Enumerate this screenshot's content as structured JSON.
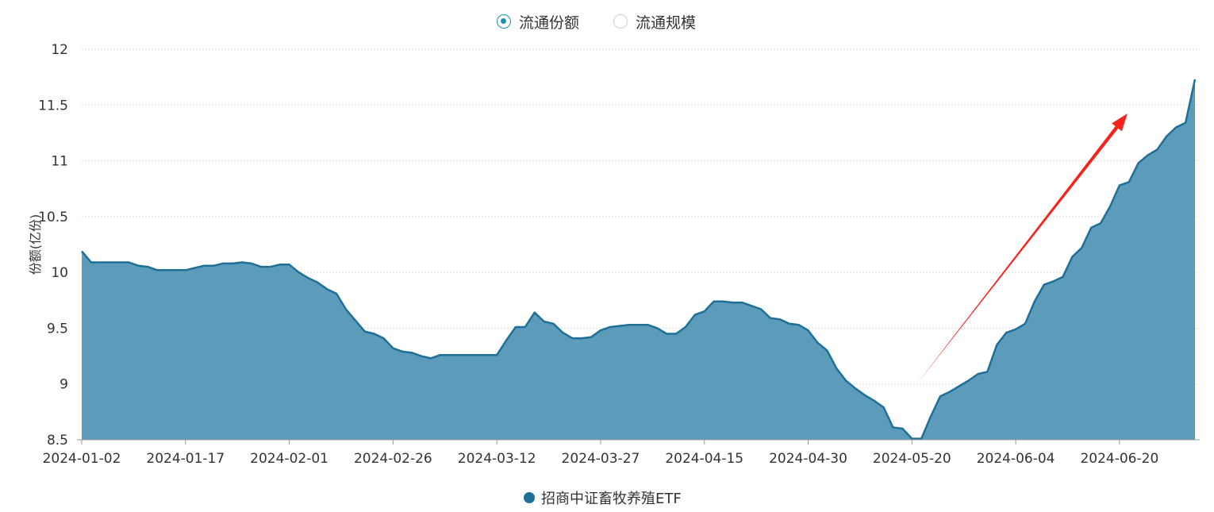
{
  "toggles": [
    {
      "label": "流通份额",
      "selected": true
    },
    {
      "label": "流通规模",
      "selected": false
    }
  ],
  "colors": {
    "series": "#1f6f97",
    "fill": "#5c9bba",
    "arrow": "#f5231c",
    "radio": "#1e8fb0"
  },
  "chart_data": {
    "type": "area",
    "ylabel": "份额(亿份)",
    "ylim": [
      8.5,
      12
    ],
    "yticks": [
      8.5,
      9,
      9.5,
      10,
      10.5,
      11,
      11.5,
      12
    ],
    "ytick_labels": [
      "8.5",
      "9",
      "9.5",
      "10",
      "10.5",
      "11",
      "11.5",
      "12"
    ],
    "xtick_labels": [
      "2024-01-02",
      "2024-01-17",
      "2024-02-01",
      "2024-02-26",
      "2024-03-12",
      "2024-03-27",
      "2024-04-15",
      "2024-04-30",
      "2024-05-20",
      "2024-06-04",
      "2024-06-20"
    ],
    "xtick_index": [
      0,
      11,
      22,
      33,
      44,
      55,
      66,
      77,
      88,
      99,
      110
    ],
    "grid": true,
    "legend_position": "bottom-center",
    "series": [
      {
        "name": "招商中证畜牧养殖ETF",
        "values": [
          10.19,
          10.09,
          10.09,
          10.09,
          10.09,
          10.09,
          10.06,
          10.05,
          10.02,
          10.02,
          10.02,
          10.02,
          10.04,
          10.06,
          10.06,
          10.08,
          10.08,
          10.09,
          10.08,
          10.05,
          10.05,
          10.07,
          10.07,
          10.0,
          9.95,
          9.91,
          9.85,
          9.81,
          9.67,
          9.57,
          9.47,
          9.45,
          9.41,
          9.32,
          9.29,
          9.28,
          9.25,
          9.23,
          9.26,
          9.26,
          9.26,
          9.26,
          9.26,
          9.26,
          9.26,
          9.39,
          9.51,
          9.51,
          9.64,
          9.56,
          9.54,
          9.46,
          9.41,
          9.41,
          9.42,
          9.48,
          9.51,
          9.52,
          9.53,
          9.53,
          9.53,
          9.5,
          9.45,
          9.45,
          9.51,
          9.62,
          9.65,
          9.74,
          9.74,
          9.73,
          9.73,
          9.7,
          9.67,
          9.59,
          9.58,
          9.54,
          9.53,
          9.48,
          9.37,
          9.3,
          9.14,
          9.03,
          8.96,
          8.9,
          8.85,
          8.79,
          8.61,
          8.6,
          8.51,
          8.51,
          8.71,
          8.89,
          8.93,
          8.98,
          9.03,
          9.09,
          9.11,
          9.35,
          9.46,
          9.49,
          9.54,
          9.74,
          9.89,
          9.92,
          9.96,
          10.14,
          10.22,
          10.4,
          10.44,
          10.59,
          10.78,
          10.81,
          10.98,
          11.05,
          11.1,
          11.22,
          11.3,
          11.34,
          11.73
        ]
      }
    ]
  }
}
